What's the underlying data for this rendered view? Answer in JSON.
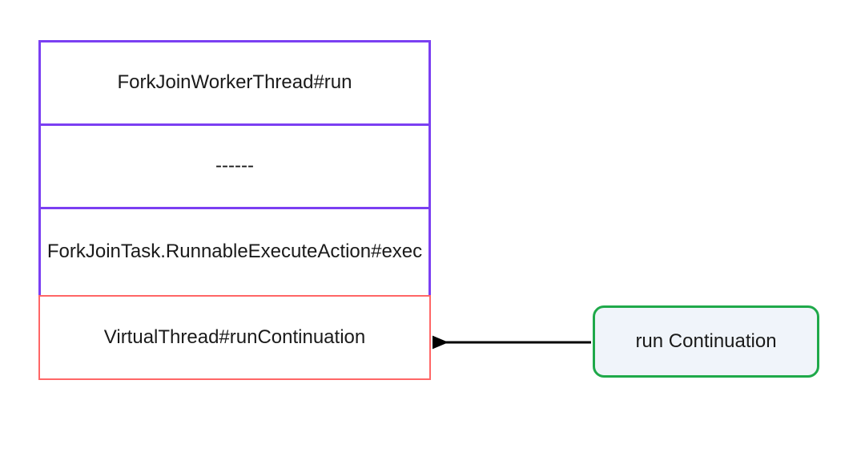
{
  "stack": {
    "cells": [
      {
        "label": "ForkJoinWorkerThread#run"
      },
      {
        "label": "------"
      },
      {
        "label": "ForkJoinTask.RunnableExecuteAction#exec"
      },
      {
        "label": "VirtualThread#runContinuation"
      }
    ]
  },
  "continuation": {
    "label": "run Continuation"
  },
  "colors": {
    "purple": "#7b3ff2",
    "red": "#ff6666",
    "green": "#1fa94a",
    "boxFill": "#f0f4fa"
  }
}
